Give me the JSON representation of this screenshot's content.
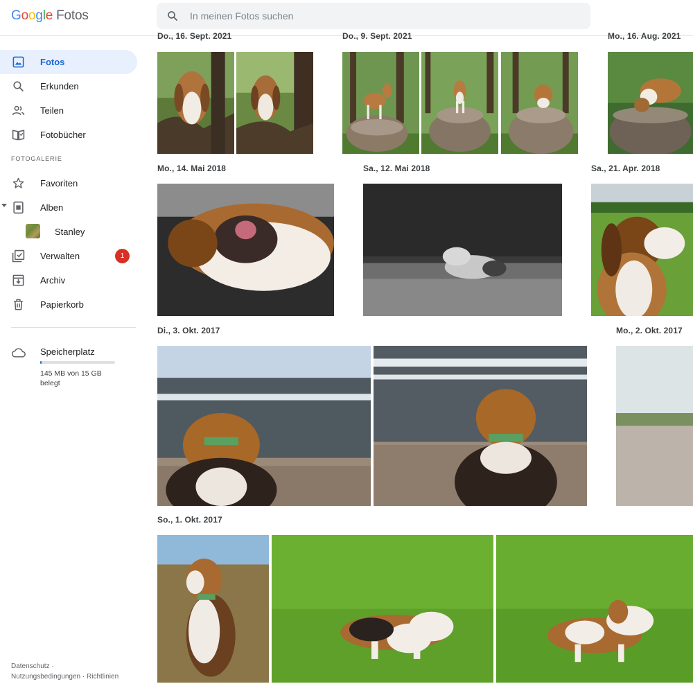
{
  "app": {
    "logo_google": [
      "G",
      "o",
      "o",
      "g",
      "l",
      "e"
    ],
    "product": "Fotos"
  },
  "search": {
    "placeholder": "In meinen Fotos suchen",
    "icon": "search-icon"
  },
  "sidebar": {
    "items": [
      {
        "label": "Fotos",
        "icon": "photo-icon",
        "active": true
      },
      {
        "label": "Erkunden",
        "icon": "search-icon"
      },
      {
        "label": "Teilen",
        "icon": "people-icon"
      },
      {
        "label": "Fotobücher",
        "icon": "book-icon"
      }
    ],
    "section_label": "FOTOGALERIE",
    "gallery_items": [
      {
        "label": "Favoriten",
        "icon": "star-icon"
      },
      {
        "label": "Alben",
        "icon": "album-icon"
      }
    ],
    "album_sub": {
      "label": "Stanley"
    },
    "more_items": [
      {
        "label": "Verwalten",
        "icon": "manage-icon",
        "badge": "1"
      },
      {
        "label": "Archiv",
        "icon": "archive-icon"
      },
      {
        "label": "Papierkorb",
        "icon": "trash-icon"
      }
    ],
    "storage": {
      "label": "Speicherplatz",
      "usage_text": "145 MB von 15 GB belegt",
      "used_fraction": 0.01,
      "icon": "cloud-icon"
    },
    "footer": {
      "privacy": "Datenschutz",
      "separator": "·",
      "terms": "Nutzungsbedingungen",
      "policies": "Richtlinien"
    }
  },
  "groups": [
    {
      "date": "Do., 16. Sept. 2021",
      "photos": [
        "beagle in tree",
        "beagle in tree"
      ]
    },
    {
      "date": "Do., 9. Sept. 2021",
      "photos": [
        "beagle on tree stump",
        "beagle on tree stump",
        "beagle on tree stump"
      ]
    },
    {
      "date": "Mo., 16. Aug. 2021",
      "photos": [
        "beagle on tree stump"
      ]
    },
    {
      "date": "Mo., 14. Mai 2018",
      "photos": [
        "sleeping beagle close-up"
      ]
    },
    {
      "date": "Sa., 12. Mai 2018",
      "photos": [
        "beagle lying in grass, black and white"
      ]
    },
    {
      "date": "Sa., 21. Apr. 2018",
      "photos": [
        "beagle portrait in field"
      ]
    },
    {
      "date": "Di., 3. Okt. 2017",
      "photos": [
        "beagle looking at sea",
        "beagle looking at sea"
      ]
    },
    {
      "date": "Mo., 2. Okt. 2017",
      "photos": [
        "beach and dunes"
      ]
    },
    {
      "date": "So., 1. Okt. 2017",
      "photos": [
        "beagle sitting in dune grass",
        "beagle on lawn",
        "beagle on lawn"
      ]
    }
  ],
  "colors": {
    "accent": "#1a73e8",
    "active_bg": "#e8f0fe",
    "badge": "#d93025"
  }
}
